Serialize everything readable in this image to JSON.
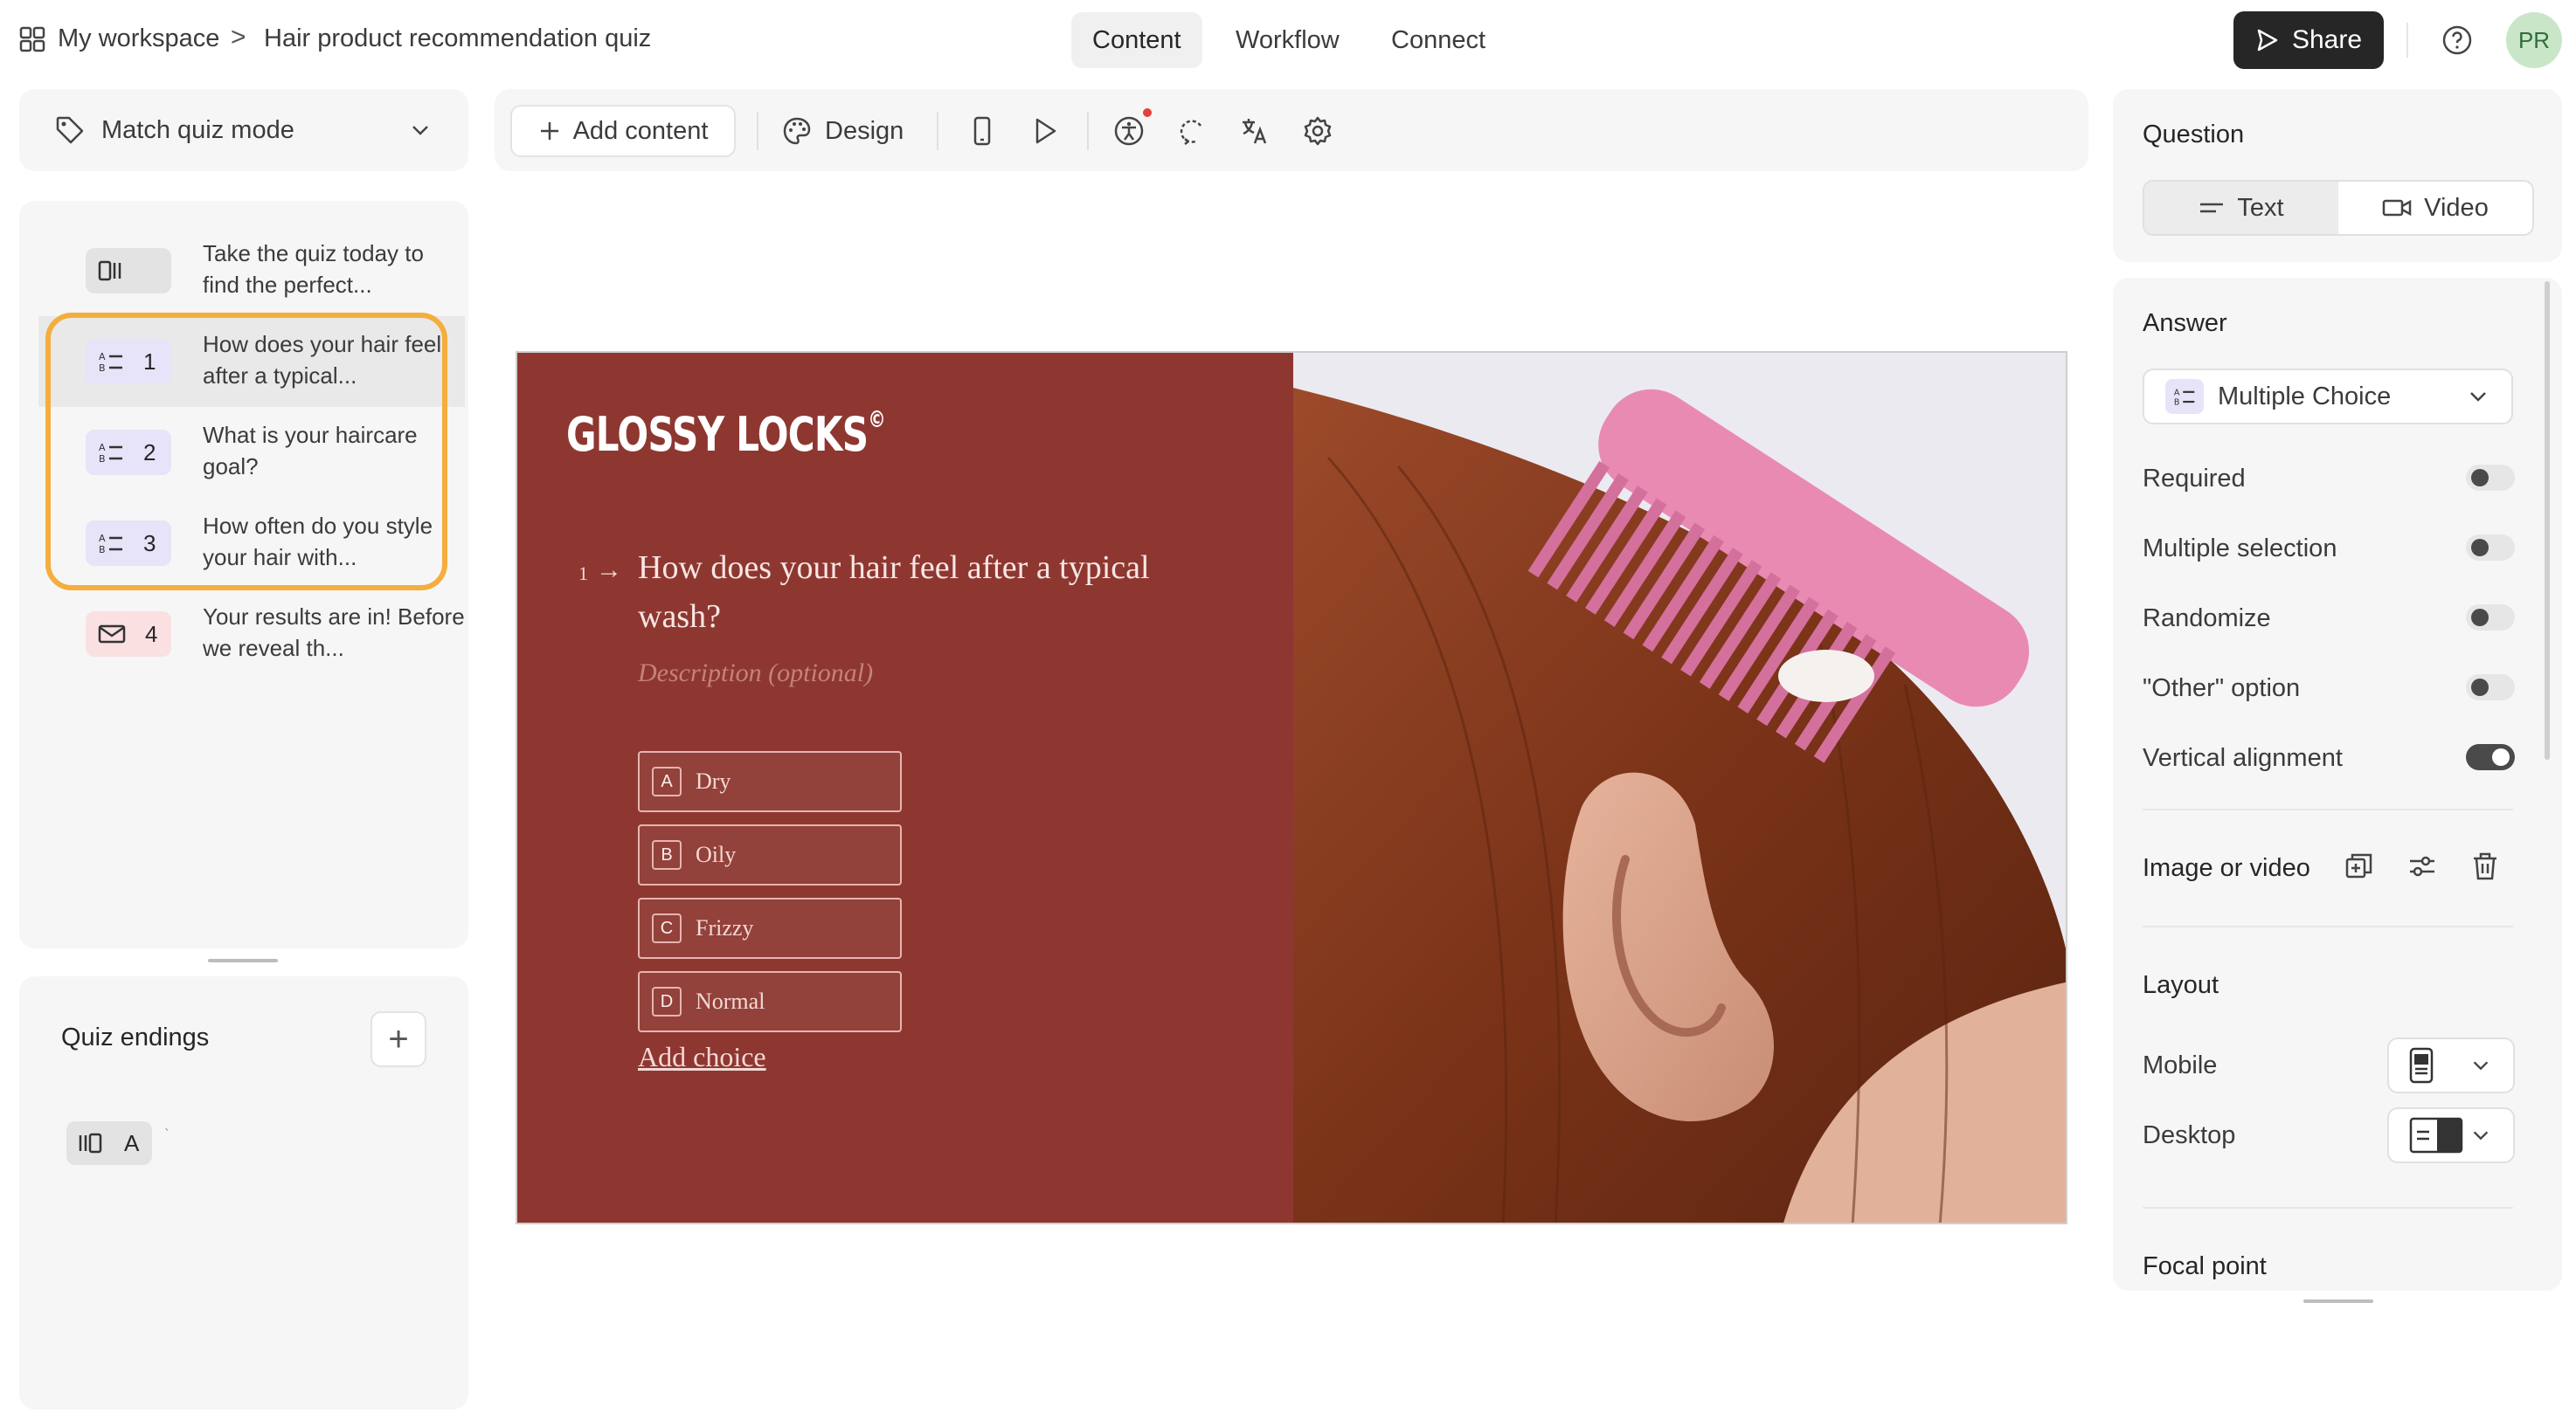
{
  "breadcrumb": {
    "workspace": "My workspace",
    "separator": ">",
    "form_title": "Hair product recommendation quiz"
  },
  "nav_tabs": [
    {
      "label": "Content",
      "active": true
    },
    {
      "label": "Workflow",
      "active": false
    },
    {
      "label": "Connect",
      "active": false
    }
  ],
  "share_label": "Share",
  "avatar_initials": "PR",
  "mode_selector": {
    "label": "Match quiz mode"
  },
  "questions": [
    {
      "badge": "",
      "icon": "welcome-screen-icon",
      "text": "Take the quiz today to find the perfect..."
    },
    {
      "badge": "1",
      "icon": "multiple-choice-icon",
      "text": "How does your hair feel after a typical...",
      "selected": true
    },
    {
      "badge": "2",
      "icon": "multiple-choice-icon",
      "text": "What is your haircare goal?"
    },
    {
      "badge": "3",
      "icon": "multiple-choice-icon",
      "text": "How often do you style your hair with..."
    },
    {
      "badge": "4",
      "icon": "email-icon",
      "text": "Your results are in! Before we reveal th..."
    }
  ],
  "quiz_endings": {
    "title": "Quiz endings",
    "add_label": "+",
    "items": [
      {
        "badge": "A",
        "icon": "ending-screen-icon",
        "text": "`"
      }
    ]
  },
  "toolbar": {
    "add_content_label": "Add content",
    "design_label": "Design",
    "icons": [
      "mobile-preview-icon",
      "play-icon",
      "accessibility-icon",
      "logic-icon",
      "translate-icon",
      "settings-icon"
    ]
  },
  "preview": {
    "brand": "GLOSSY LOCKS",
    "brand_mark": "©",
    "question_number": "1",
    "question": "How does your hair feel after a typical wash?",
    "description_placeholder": "Description (optional)",
    "choices": [
      {
        "key": "A",
        "label": "Dry"
      },
      {
        "key": "B",
        "label": "Oily"
      },
      {
        "key": "C",
        "label": "Frizzy"
      },
      {
        "key": "D",
        "label": "Normal"
      }
    ],
    "add_choice_label": "Add choice",
    "colors": {
      "background": "#8e3731",
      "accent": "#f4d9d5"
    }
  },
  "right_panel": {
    "question_title": "Question",
    "question_types": [
      {
        "label": "Text",
        "icon": "text-icon",
        "active": true
      },
      {
        "label": "Video",
        "icon": "video-icon",
        "active": false
      }
    ],
    "answer_title": "Answer",
    "answer_type": "Multiple Choice",
    "toggles": [
      {
        "label": "Required",
        "on": false
      },
      {
        "label": "Multiple selection",
        "on": false
      },
      {
        "label": "Randomize",
        "on": false
      },
      {
        "label": "\"Other\" option",
        "on": false
      },
      {
        "label": "Vertical alignment",
        "on": true
      }
    ],
    "image_or_video_title": "Image or video",
    "layout_title": "Layout",
    "layout_mobile_label": "Mobile",
    "layout_desktop_label": "Desktop",
    "focal_point_title": "Focal point"
  },
  "colors": {
    "highlight": "#f4ae3d",
    "share_button": "#262627",
    "avatar_bg": "#c9e6c9"
  }
}
